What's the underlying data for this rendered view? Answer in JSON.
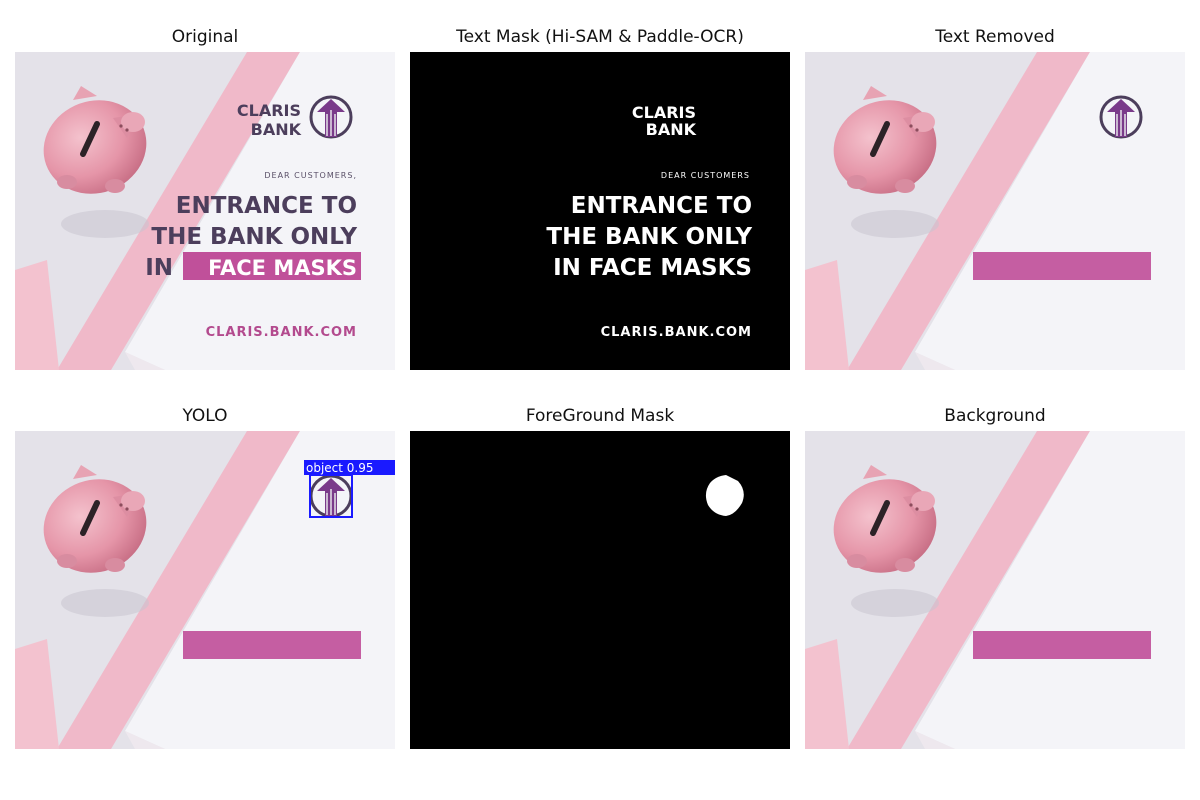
{
  "figure": {
    "panels": [
      {
        "title": "Original"
      },
      {
        "title": "Text Mask (Hi-SAM & Paddle-OCR)"
      },
      {
        "title": "Text Removed"
      },
      {
        "title": "YOLO"
      },
      {
        "title": "ForeGround Mask"
      },
      {
        "title": "Background"
      }
    ]
  },
  "poster": {
    "brand_line1": "CLARIS",
    "brand_line2": "BANK",
    "greeting": "DEAR CUSTOMERS,",
    "headline_line1": "ENTRANCE TO",
    "headline_line2": "THE BANK ONLY",
    "headline_line3_prefix": "IN",
    "headline_line3_highlight": "FACE MASKS",
    "url": "CLARIS.BANK.COM"
  },
  "mask_text": {
    "brand_line1": "CLARIS",
    "brand_line2": "BANK",
    "greeting": "DEAR CUSTOMERS",
    "headline_line1": "ENTRANCE TO",
    "headline_line2": "THE BANK ONLY",
    "headline_line3": "IN FACE MASKS",
    "url": "CLARIS.BANK.COM"
  },
  "detection": {
    "label": "object",
    "score": "0.95",
    "label_text": "object 0.95"
  },
  "colors": {
    "background_gray": "#e4e2e9",
    "pink_stripe": "#f0b9c9",
    "white_paper": "#f4f4f8",
    "highlight_magenta": "#c0509a",
    "headline_purple": "#4c3e5c",
    "url_magenta": "#b34a8e",
    "logo_purple": "#7a3a8a",
    "bbox_blue": "#1a1aff",
    "mask_black": "#000000",
    "mask_white": "#ffffff"
  }
}
